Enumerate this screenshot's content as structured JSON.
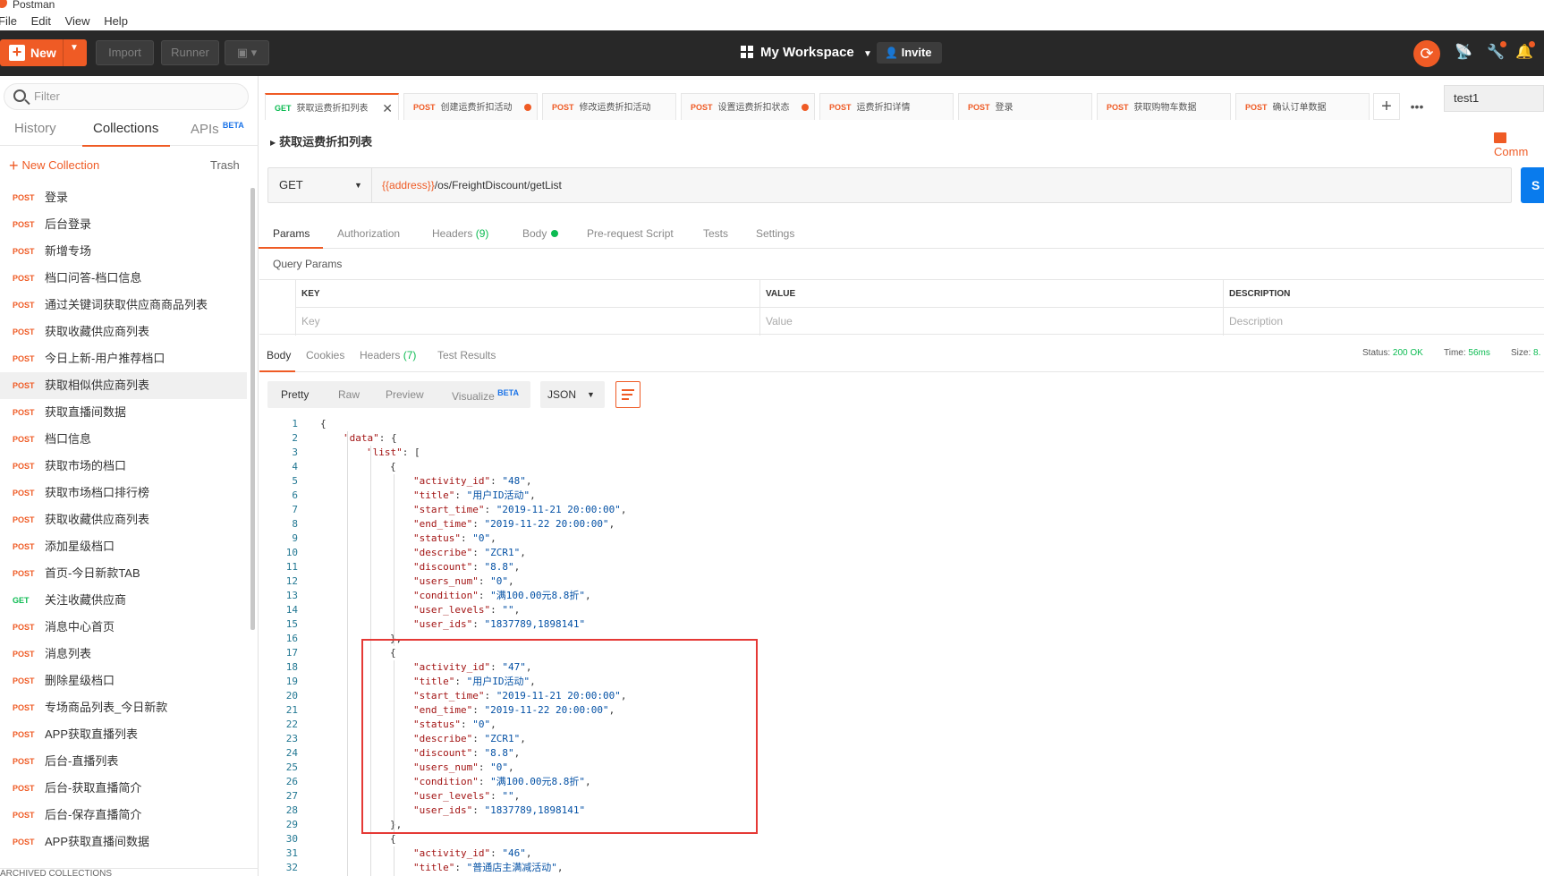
{
  "app_title": "Postman",
  "menu": [
    "File",
    "Edit",
    "View",
    "Help"
  ],
  "toolbar": {
    "new_label": "New",
    "import_label": "Import",
    "runner_label": "Runner",
    "workspace": "My Workspace",
    "invite_label": "Invite"
  },
  "sidebar": {
    "filter_placeholder": "Filter",
    "tabs": [
      "History",
      "Collections",
      "APIs"
    ],
    "beta": "BETA",
    "new_collection": "New Collection",
    "trash": "Trash",
    "items": [
      {
        "method": "POST",
        "name": "登录"
      },
      {
        "method": "POST",
        "name": "后台登录"
      },
      {
        "method": "POST",
        "name": "新增专场"
      },
      {
        "method": "POST",
        "name": "档口问答-档口信息"
      },
      {
        "method": "POST",
        "name": "通过关键词获取供应商商品列表"
      },
      {
        "method": "POST",
        "name": "获取收藏供应商列表"
      },
      {
        "method": "POST",
        "name": "今日上新-用户推荐档口"
      },
      {
        "method": "POST",
        "name": "获取相似供应商列表"
      },
      {
        "method": "POST",
        "name": "获取直播间数据"
      },
      {
        "method": "POST",
        "name": "档口信息"
      },
      {
        "method": "POST",
        "name": "获取市场的档口"
      },
      {
        "method": "POST",
        "name": "获取市场档口排行榜"
      },
      {
        "method": "POST",
        "name": "获取收藏供应商列表"
      },
      {
        "method": "POST",
        "name": "添加星级档口"
      },
      {
        "method": "POST",
        "name": "首页-今日新款TAB"
      },
      {
        "method": "GET",
        "name": "关注收藏供应商"
      },
      {
        "method": "POST",
        "name": "消息中心首页"
      },
      {
        "method": "POST",
        "name": "消息列表"
      },
      {
        "method": "POST",
        "name": "删除星级档口"
      },
      {
        "method": "POST",
        "name": "专场商品列表_今日新款"
      },
      {
        "method": "POST",
        "name": "APP获取直播列表"
      },
      {
        "method": "POST",
        "name": "后台-直播列表"
      },
      {
        "method": "POST",
        "name": "后台-获取直播简介"
      },
      {
        "method": "POST",
        "name": "后台-保存直播简介"
      },
      {
        "method": "POST",
        "name": "APP获取直播间数据"
      }
    ],
    "bottom_text": "ARCHIVED COLLECTIONS"
  },
  "request_tabs": [
    {
      "method": "GET",
      "name": "获取运费折扣列表",
      "active": true
    },
    {
      "method": "POST",
      "name": "创建运费折扣活动",
      "dot": true
    },
    {
      "method": "POST",
      "name": "修改运费折扣活动"
    },
    {
      "method": "POST",
      "name": "设置运费折扣状态",
      "dot": true
    },
    {
      "method": "POST",
      "name": "运费折扣详情"
    },
    {
      "method": "POST",
      "name": "登录"
    },
    {
      "method": "POST",
      "name": "获取购物车数据"
    },
    {
      "method": "POST",
      "name": "确认订单数据"
    }
  ],
  "environment": "test1",
  "request": {
    "title": "获取运费折扣列表",
    "comments": "Comm",
    "method": "GET",
    "url_var": "{{address}}",
    "url_path": "/os/FreightDiscount/getList",
    "send": "S"
  },
  "req_tabs": {
    "params": "Params",
    "authorization": "Authorization",
    "headers": "Headers",
    "headers_count": "(9)",
    "body": "Body",
    "prerequest": "Pre-request Script",
    "tests": "Tests",
    "settings": "Settings"
  },
  "query": {
    "title": "Query Params",
    "key": "KEY",
    "value": "VALUE",
    "description": "DESCRIPTION",
    "key_ph": "Key",
    "value_ph": "Value",
    "desc_ph": "Description"
  },
  "response": {
    "tabs": {
      "body": "Body",
      "cookies": "Cookies",
      "headers": "Headers",
      "headers_count": "(7)",
      "tests": "Test Results"
    },
    "status_label": "Status:",
    "status_value": "200 OK",
    "time_label": "Time:",
    "time_value": "56ms",
    "size_label": "Size:",
    "size_value": "8.",
    "views": {
      "pretty": "Pretty",
      "raw": "Raw",
      "preview": "Preview",
      "visualize": "Visualize",
      "beta": "BETA"
    },
    "format": "JSON"
  },
  "code_lines": [
    {
      "n": "1",
      "i": 0,
      "t": "{"
    },
    {
      "n": "2",
      "i": 1,
      "k": "\"data\"",
      "r": ": {"
    },
    {
      "n": "3",
      "i": 2,
      "k": "\"list\"",
      "r": ": ["
    },
    {
      "n": "4",
      "i": 3,
      "t": "{"
    },
    {
      "n": "5",
      "i": 4,
      "k": "\"activity_id\"",
      "r": ": ",
      "s": "\"48\"",
      "e": ","
    },
    {
      "n": "6",
      "i": 4,
      "k": "\"title\"",
      "r": ": ",
      "s": "\"用户ID活动\"",
      "e": ","
    },
    {
      "n": "7",
      "i": 4,
      "k": "\"start_time\"",
      "r": ": ",
      "s": "\"2019-11-21 20:00:00\"",
      "e": ","
    },
    {
      "n": "8",
      "i": 4,
      "k": "\"end_time\"",
      "r": ": ",
      "s": "\"2019-11-22 20:00:00\"",
      "e": ","
    },
    {
      "n": "9",
      "i": 4,
      "k": "\"status\"",
      "r": ": ",
      "s": "\"0\"",
      "e": ","
    },
    {
      "n": "10",
      "i": 4,
      "k": "\"describe\"",
      "r": ": ",
      "s": "\"ZCR1\"",
      "e": ","
    },
    {
      "n": "11",
      "i": 4,
      "k": "\"discount\"",
      "r": ": ",
      "s": "\"8.8\"",
      "e": ","
    },
    {
      "n": "12",
      "i": 4,
      "k": "\"users_num\"",
      "r": ": ",
      "s": "\"0\"",
      "e": ","
    },
    {
      "n": "13",
      "i": 4,
      "k": "\"condition\"",
      "r": ": ",
      "s": "\"满100.00元8.8折\"",
      "e": ","
    },
    {
      "n": "14",
      "i": 4,
      "k": "\"user_levels\"",
      "r": ": ",
      "s": "\"\"",
      "e": ","
    },
    {
      "n": "15",
      "i": 4,
      "k": "\"user_ids\"",
      "r": ": ",
      "s": "\"1837789,1898141\"",
      "e": ""
    },
    {
      "n": "16",
      "i": 3,
      "t": "},"
    },
    {
      "n": "17",
      "i": 3,
      "t": "{"
    },
    {
      "n": "18",
      "i": 4,
      "k": "\"activity_id\"",
      "r": ": ",
      "s": "\"47\"",
      "e": ","
    },
    {
      "n": "19",
      "i": 4,
      "k": "\"title\"",
      "r": ": ",
      "s": "\"用户ID活动\"",
      "e": ","
    },
    {
      "n": "20",
      "i": 4,
      "k": "\"start_time\"",
      "r": ": ",
      "s": "\"2019-11-21 20:00:00\"",
      "e": ","
    },
    {
      "n": "21",
      "i": 4,
      "k": "\"end_time\"",
      "r": ": ",
      "s": "\"2019-11-22 20:00:00\"",
      "e": ","
    },
    {
      "n": "22",
      "i": 4,
      "k": "\"status\"",
      "r": ": ",
      "s": "\"0\"",
      "e": ","
    },
    {
      "n": "23",
      "i": 4,
      "k": "\"describe\"",
      "r": ": ",
      "s": "\"ZCR1\"",
      "e": ","
    },
    {
      "n": "24",
      "i": 4,
      "k": "\"discount\"",
      "r": ": ",
      "s": "\"8.8\"",
      "e": ","
    },
    {
      "n": "25",
      "i": 4,
      "k": "\"users_num\"",
      "r": ": ",
      "s": "\"0\"",
      "e": ","
    },
    {
      "n": "26",
      "i": 4,
      "k": "\"condition\"",
      "r": ": ",
      "s": "\"满100.00元8.8折\"",
      "e": ","
    },
    {
      "n": "27",
      "i": 4,
      "k": "\"user_levels\"",
      "r": ": ",
      "s": "\"\"",
      "e": ","
    },
    {
      "n": "28",
      "i": 4,
      "k": "\"user_ids\"",
      "r": ": ",
      "s": "\"1837789,1898141\"",
      "e": ""
    },
    {
      "n": "29",
      "i": 3,
      "t": "},"
    },
    {
      "n": "30",
      "i": 3,
      "t": "{"
    },
    {
      "n": "31",
      "i": 4,
      "k": "\"activity_id\"",
      "r": ": ",
      "s": "\"46\"",
      "e": ","
    },
    {
      "n": "32",
      "i": 4,
      "k": "\"title\"",
      "r": ": ",
      "s": "\"普通店主满减活动\"",
      "e": ","
    }
  ],
  "colors": {
    "accent": "#ef5b25",
    "get": "#0cbb52",
    "send": "#097bed",
    "topbar": "#282828",
    "highlight_box": "#e53935"
  }
}
